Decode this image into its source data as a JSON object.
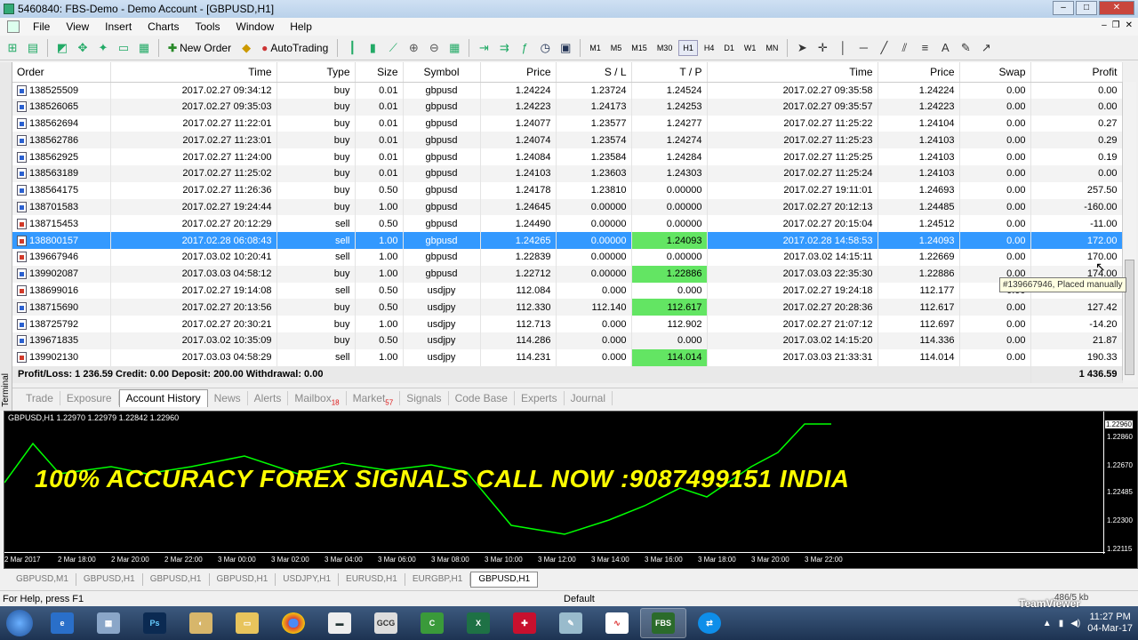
{
  "window": {
    "title": "5460840: FBS-Demo - Demo Account - [GBPUSD,H1]"
  },
  "menu": [
    "File",
    "View",
    "Insert",
    "Charts",
    "Tools",
    "Window",
    "Help"
  ],
  "toolbar": {
    "new_order_label": "New Order",
    "autotrading_label": "AutoTrading",
    "timeframes": [
      "M1",
      "M5",
      "M15",
      "M30",
      "H1",
      "H4",
      "D1",
      "W1",
      "MN"
    ],
    "active_timeframe": "H1"
  },
  "table": {
    "columns": [
      "Order",
      "Time",
      "Type",
      "Size",
      "Symbol",
      "Price",
      "S / L",
      "T / P",
      "Time",
      "Price",
      "Swap",
      "Profit"
    ],
    "rows": [
      {
        "order": "138525509",
        "time": "2017.02.27 09:34:12",
        "type": "buy",
        "size": "0.01",
        "symbol": "gbpusd",
        "price": "1.24224",
        "sl": "1.23724",
        "tp": "1.24524",
        "ctime": "2017.02.27 09:35:58",
        "cprice": "1.24224",
        "swap": "0.00",
        "profit": "0.00",
        "tp_green": false
      },
      {
        "order": "138526065",
        "time": "2017.02.27 09:35:03",
        "type": "buy",
        "size": "0.01",
        "symbol": "gbpusd",
        "price": "1.24223",
        "sl": "1.24173",
        "tp": "1.24253",
        "ctime": "2017.02.27 09:35:57",
        "cprice": "1.24223",
        "swap": "0.00",
        "profit": "0.00",
        "tp_green": false
      },
      {
        "order": "138562694",
        "time": "2017.02.27 11:22:01",
        "type": "buy",
        "size": "0.01",
        "symbol": "gbpusd",
        "price": "1.24077",
        "sl": "1.23577",
        "tp": "1.24277",
        "ctime": "2017.02.27 11:25:22",
        "cprice": "1.24104",
        "swap": "0.00",
        "profit": "0.27",
        "tp_green": false
      },
      {
        "order": "138562786",
        "time": "2017.02.27 11:23:01",
        "type": "buy",
        "size": "0.01",
        "symbol": "gbpusd",
        "price": "1.24074",
        "sl": "1.23574",
        "tp": "1.24274",
        "ctime": "2017.02.27 11:25:23",
        "cprice": "1.24103",
        "swap": "0.00",
        "profit": "0.29",
        "tp_green": false
      },
      {
        "order": "138562925",
        "time": "2017.02.27 11:24:00",
        "type": "buy",
        "size": "0.01",
        "symbol": "gbpusd",
        "price": "1.24084",
        "sl": "1.23584",
        "tp": "1.24284",
        "ctime": "2017.02.27 11:25:25",
        "cprice": "1.24103",
        "swap": "0.00",
        "profit": "0.19",
        "tp_green": false
      },
      {
        "order": "138563189",
        "time": "2017.02.27 11:25:02",
        "type": "buy",
        "size": "0.01",
        "symbol": "gbpusd",
        "price": "1.24103",
        "sl": "1.23603",
        "tp": "1.24303",
        "ctime": "2017.02.27 11:25:24",
        "cprice": "1.24103",
        "swap": "0.00",
        "profit": "0.00",
        "tp_green": false
      },
      {
        "order": "138564175",
        "time": "2017.02.27 11:26:36",
        "type": "buy",
        "size": "0.50",
        "symbol": "gbpusd",
        "price": "1.24178",
        "sl": "1.23810",
        "tp": "0.00000",
        "ctime": "2017.02.27 19:11:01",
        "cprice": "1.24693",
        "swap": "0.00",
        "profit": "257.50",
        "tp_green": false
      },
      {
        "order": "138701583",
        "time": "2017.02.27 19:24:44",
        "type": "buy",
        "size": "1.00",
        "symbol": "gbpusd",
        "price": "1.24645",
        "sl": "0.00000",
        "tp": "0.00000",
        "ctime": "2017.02.27 20:12:13",
        "cprice": "1.24485",
        "swap": "0.00",
        "profit": "-160.00",
        "tp_green": false
      },
      {
        "order": "138715453",
        "time": "2017.02.27 20:12:29",
        "type": "sell",
        "size": "0.50",
        "symbol": "gbpusd",
        "price": "1.24490",
        "sl": "0.00000",
        "tp": "0.00000",
        "ctime": "2017.02.27 20:15:04",
        "cprice": "1.24512",
        "swap": "0.00",
        "profit": "-11.00",
        "tp_green": false
      },
      {
        "order": "138800157",
        "time": "2017.02.28 06:08:43",
        "type": "sell",
        "size": "1.00",
        "symbol": "gbpusd",
        "price": "1.24265",
        "sl": "0.00000",
        "tp": "1.24093",
        "ctime": "2017.02.28 14:58:53",
        "cprice": "1.24093",
        "swap": "0.00",
        "profit": "172.00",
        "tp_green": true,
        "selected": true
      },
      {
        "order": "139667946",
        "time": "2017.03.02 10:20:41",
        "type": "sell",
        "size": "1.00",
        "symbol": "gbpusd",
        "price": "1.22839",
        "sl": "0.00000",
        "tp": "0.00000",
        "ctime": "2017.03.02 14:15:11",
        "cprice": "1.22669",
        "swap": "0.00",
        "profit": "170.00",
        "tp_green": false
      },
      {
        "order": "139902087",
        "time": "2017.03.03 04:58:12",
        "type": "buy",
        "size": "1.00",
        "symbol": "gbpusd",
        "price": "1.22712",
        "sl": "0.00000",
        "tp": "1.22886",
        "ctime": "2017.03.03 22:35:30",
        "cprice": "1.22886",
        "swap": "0.00",
        "profit": "174.00",
        "tp_green": true
      },
      {
        "order": "138699016",
        "time": "2017.02.27 19:14:08",
        "type": "sell",
        "size": "0.50",
        "symbol": "usdjpy",
        "price": "112.084",
        "sl": "0.000",
        "tp": "0.000",
        "ctime": "2017.02.27 19:24:18",
        "cprice": "112.177",
        "swap": "0.00",
        "profit": "",
        "tp_green": false
      },
      {
        "order": "138715690",
        "time": "2017.02.27 20:13:56",
        "type": "buy",
        "size": "0.50",
        "symbol": "usdjpy",
        "price": "112.330",
        "sl": "112.140",
        "tp": "112.617",
        "ctime": "2017.02.27 20:28:36",
        "cprice": "112.617",
        "swap": "0.00",
        "profit": "127.42",
        "tp_green": true
      },
      {
        "order": "138725792",
        "time": "2017.02.27 20:30:21",
        "type": "buy",
        "size": "1.00",
        "symbol": "usdjpy",
        "price": "112.713",
        "sl": "0.000",
        "tp": "112.902",
        "ctime": "2017.02.27 21:07:12",
        "cprice": "112.697",
        "swap": "0.00",
        "profit": "-14.20",
        "tp_green": false
      },
      {
        "order": "139671835",
        "time": "2017.03.02 10:35:09",
        "type": "buy",
        "size": "0.50",
        "symbol": "usdjpy",
        "price": "114.286",
        "sl": "0.000",
        "tp": "0.000",
        "ctime": "2017.03.02 14:15:20",
        "cprice": "114.336",
        "swap": "0.00",
        "profit": "21.87",
        "tp_green": false
      },
      {
        "order": "139902130",
        "time": "2017.03.03 04:58:29",
        "type": "sell",
        "size": "1.00",
        "symbol": "usdjpy",
        "price": "114.231",
        "sl": "0.000",
        "tp": "114.014",
        "ctime": "2017.03.03 21:33:31",
        "cprice": "114.014",
        "swap": "0.00",
        "profit": "190.33",
        "tp_green": true
      }
    ],
    "summary": {
      "text": "Profit/Loss: 1 236.59  Credit: 0.00  Deposit: 200.00  Withdrawal: 0.00",
      "total": "1 436.59"
    }
  },
  "tooltip": "#139667946, Placed manually",
  "terminal_label": "Terminal",
  "tabs": [
    {
      "label": "Trade",
      "badge": ""
    },
    {
      "label": "Exposure",
      "badge": ""
    },
    {
      "label": "Account History",
      "badge": "",
      "active": true
    },
    {
      "label": "News",
      "badge": ""
    },
    {
      "label": "Alerts",
      "badge": ""
    },
    {
      "label": "Mailbox",
      "badge": "18"
    },
    {
      "label": "Market",
      "badge": "57"
    },
    {
      "label": "Signals",
      "badge": ""
    },
    {
      "label": "Code Base",
      "badge": ""
    },
    {
      "label": "Experts",
      "badge": ""
    },
    {
      "label": "Journal",
      "badge": ""
    }
  ],
  "chart": {
    "symbol_info": "GBPUSD,H1  1.22970 1.22979 1.22842 1.22960",
    "overlay_text": "100% ACCURACY FOREX SIGNALS CALL NOW :9087499151 INDIA",
    "price_labels": [
      "1.22860",
      "1.22670",
      "1.22485",
      "1.22300",
      "1.22115"
    ],
    "current_price": "1.22960",
    "time_labels": [
      "2 Mar 2017",
      "2 Mar 18:00",
      "2 Mar 20:00",
      "2 Mar 22:00",
      "3 Mar 00:00",
      "3 Mar 02:00",
      "3 Mar 04:00",
      "3 Mar 06:00",
      "3 Mar 08:00",
      "3 Mar 10:00",
      "3 Mar 12:00",
      "3 Mar 14:00",
      "3 Mar 16:00",
      "3 Mar 18:00",
      "3 Mar 20:00",
      "3 Mar 22:00"
    ],
    "line_color": "#00ff00"
  },
  "chart_tabs": [
    {
      "label": "GBPUSD,M1"
    },
    {
      "label": "GBPUSD,H1"
    },
    {
      "label": "GBPUSD,H1"
    },
    {
      "label": "GBPUSD,H1"
    },
    {
      "label": "USDJPY,H1"
    },
    {
      "label": "EURUSD,H1"
    },
    {
      "label": "EURGBP,H1"
    },
    {
      "label": "GBPUSD,H1",
      "active": true
    }
  ],
  "status": {
    "help": "For Help, press F1",
    "profile": "Default",
    "connection": "486/5 kb"
  },
  "taskbar": {
    "apps": [
      "ie",
      "calc",
      "ps",
      "paint",
      "folder",
      "chrome",
      "news",
      "gcg",
      "ca",
      "excel",
      "uk",
      "pen",
      "chart",
      "FBS",
      "tv"
    ],
    "teamviewer": "TeamViewer",
    "time": "11:27 PM",
    "date": "04-Mar-17"
  }
}
